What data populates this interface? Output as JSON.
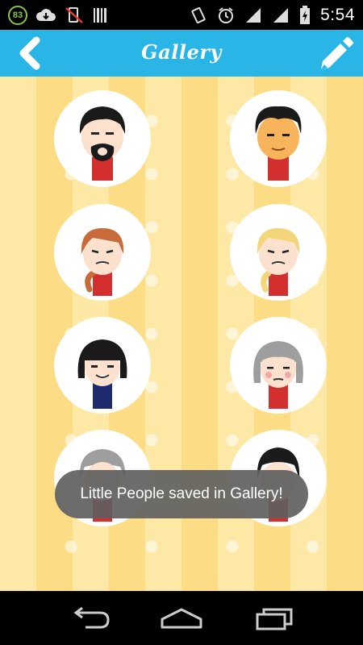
{
  "status_bar": {
    "battery_badge": "83",
    "time": "5:54",
    "icons": [
      "download-cloud-icon",
      "mute-icon",
      "barcode-icon",
      "rotate-icon",
      "alarm-icon",
      "signal-icon",
      "signal-icon-2",
      "battery-charging-icon"
    ]
  },
  "header": {
    "title": "Gallery",
    "back_icon": "chevron-left-icon",
    "edit_icon": "pencil-icon",
    "bg_color": "#29b6e6"
  },
  "gallery": {
    "items": [
      {
        "name": "avatar-bearded-man"
      },
      {
        "name": "avatar-tan-man"
      },
      {
        "name": "avatar-auburn-ponytail-girl"
      },
      {
        "name": "avatar-blonde-ponytail-girl"
      },
      {
        "name": "avatar-black-bob-girl"
      },
      {
        "name": "avatar-gray-hair-woman"
      },
      {
        "name": "avatar-gray-person-partial"
      },
      {
        "name": "avatar-black-hair-partial"
      }
    ]
  },
  "toast": {
    "message": "Little People saved in Gallery!"
  },
  "nav_bar": {
    "icons": [
      "back-arrow-icon",
      "home-icon",
      "recent-apps-icon"
    ]
  }
}
